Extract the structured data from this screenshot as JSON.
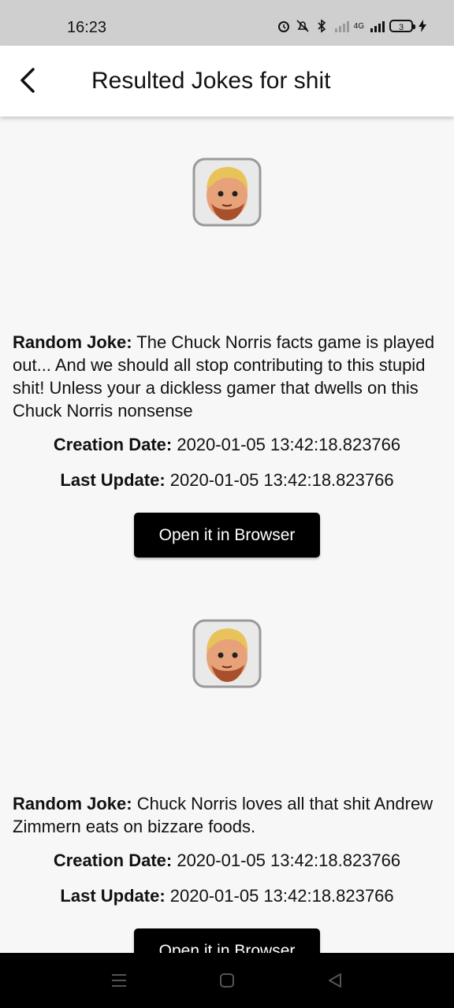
{
  "status_bar": {
    "time": "16:23",
    "network_label": "4G",
    "battery_level": "3"
  },
  "appbar": {
    "title": "Resulted Jokes for shit"
  },
  "jokes": [
    {
      "label": "Random Joke:",
      "text": " The Chuck Norris facts game is played out... And we should all stop contributing to this stupid shit! Unless your a dickless gamer that dwells on this Chuck Norris nonsense",
      "creation_label": "Creation Date:",
      "creation_date": " 2020-01-05 13:42:18.823766",
      "update_label": "Last Update:",
      "update_date": " 2020-01-05 13:42:18.823766",
      "button_label": "Open it in Browser"
    },
    {
      "label": "Random Joke:",
      "text": " Chuck Norris loves all that shit Andrew Zimmern eats on bizzare foods.",
      "creation_label": "Creation Date:",
      "creation_date": " 2020-01-05 13:42:18.823766",
      "update_label": "Last Update:",
      "update_date": " 2020-01-05 13:42:18.823766",
      "button_label": "Open it in Browser"
    }
  ],
  "colors": {
    "background": "#f7f7f7",
    "button": "#000000",
    "appbar": "#ffffff"
  }
}
